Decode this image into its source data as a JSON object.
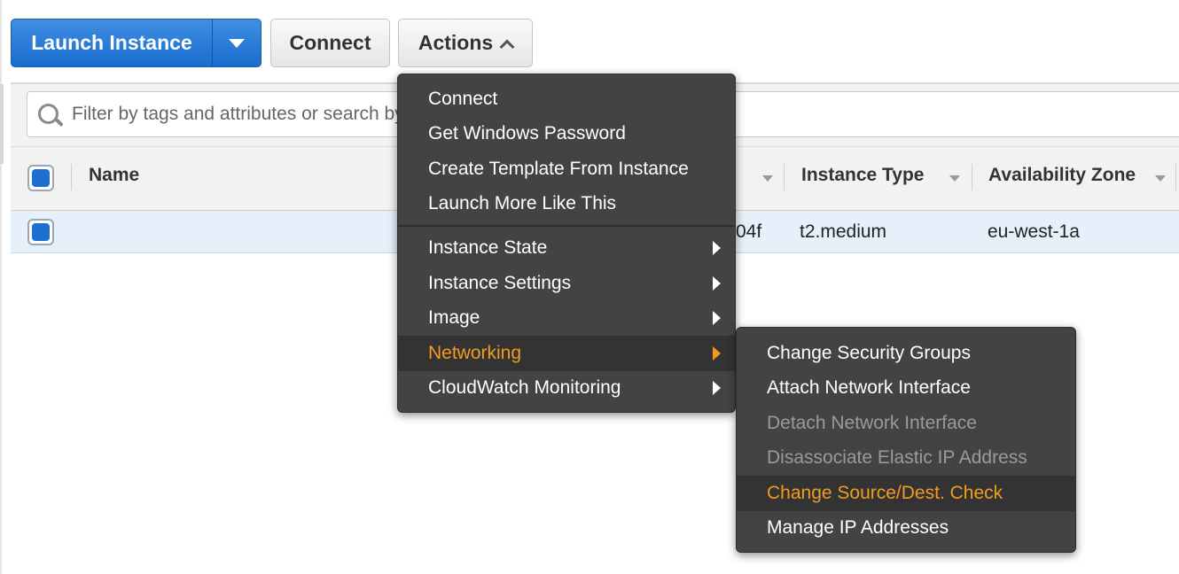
{
  "toolbar": {
    "launch_label": "Launch Instance",
    "connect_label": "Connect",
    "actions_label": "Actions"
  },
  "search": {
    "placeholder": "Filter by tags and attributes or search by keyword"
  },
  "table": {
    "headers": {
      "name": "Name",
      "instance_type": "Instance Type",
      "availability_zone": "Availability Zone"
    },
    "row": {
      "instance_id_fragment": "04f",
      "instance_type": "t2.medium",
      "availability_zone": "eu-west-1a"
    }
  },
  "actions_menu": {
    "group1": [
      "Connect",
      "Get Windows Password",
      "Create Template From Instance",
      "Launch More Like This"
    ],
    "group2": [
      "Instance State",
      "Instance Settings",
      "Image",
      "Networking",
      "CloudWatch Monitoring"
    ],
    "highlighted": "Networking"
  },
  "networking_submenu": {
    "items": [
      "Change Security Groups",
      "Attach Network Interface",
      "Detach Network Interface",
      "Disassociate Elastic IP Address",
      "Change Source/Dest. Check",
      "Manage IP Addresses"
    ],
    "disabled": [
      "Detach Network Interface",
      "Disassociate Elastic IP Address"
    ],
    "highlighted": "Change Source/Dest. Check"
  },
  "colors": {
    "primary_button": "#1a6ccf",
    "menu_background": "#434343",
    "menu_highlight_text": "#f29b20",
    "selected_row": "#e6f0fb"
  },
  "icons": [
    "caret-down-icon",
    "chevron-up-icon",
    "search-icon",
    "submenu-arrow-icon"
  ]
}
